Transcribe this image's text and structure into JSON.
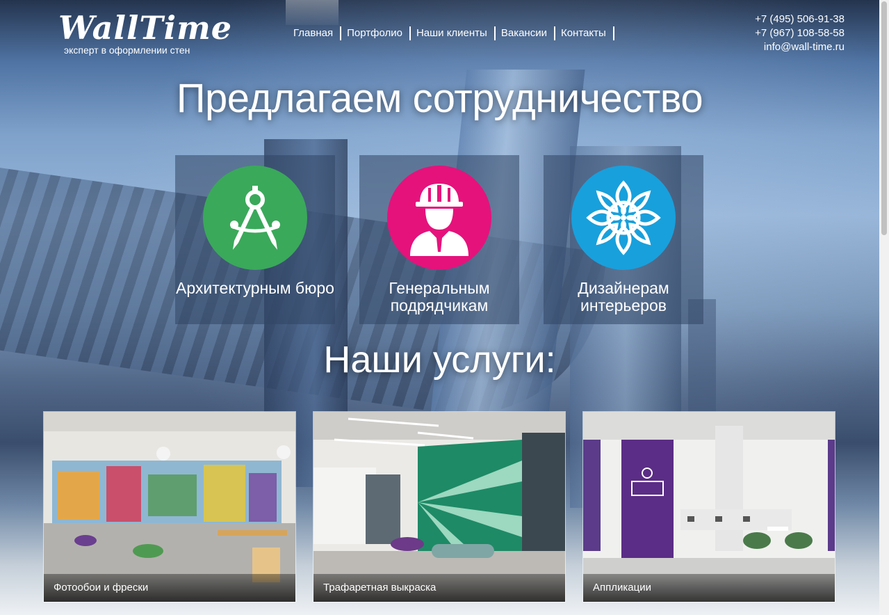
{
  "header": {
    "logo": "WallTime",
    "tagline": "эксперт в оформлении стен",
    "nav": [
      "Главная",
      "Портфолио",
      "Наши клиенты",
      "Вакансии",
      "Контакты"
    ],
    "contacts": {
      "phone1": "+7 (495) 506-91-38",
      "phone2": "+7 (967) 108-58-58",
      "email": "info@wall-time.ru"
    }
  },
  "offer": {
    "title": "Предлагаем сотрудничество",
    "cards": [
      {
        "label": "Архитектурным бюро",
        "icon": "compass-icon",
        "color": "#3aa95a"
      },
      {
        "label": "Генеральным подрядчикам",
        "icon": "builder-icon",
        "color": "#e5127c"
      },
      {
        "label": "Дизайнерам интерьеров",
        "icon": "flower-icon",
        "color": "#18a0dc"
      }
    ]
  },
  "services": {
    "title": "Наши услуги:",
    "items": [
      {
        "caption": "Фотообои и фрески"
      },
      {
        "caption": "Трафаретная выкраска"
      },
      {
        "caption": "Аппликации"
      }
    ]
  }
}
